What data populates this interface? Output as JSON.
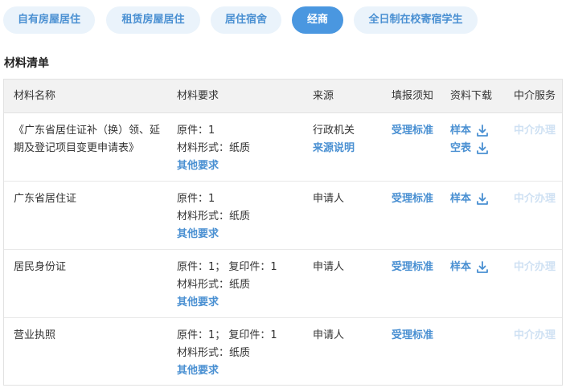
{
  "tabs": [
    {
      "label": "自有房屋居住",
      "active": false
    },
    {
      "label": "租赁房屋居住",
      "active": false
    },
    {
      "label": "居住宿舍",
      "active": false
    },
    {
      "label": "经商",
      "active": true
    },
    {
      "label": "全日制在校寄宿学生",
      "active": false
    }
  ],
  "section_title": "材料清单",
  "table": {
    "headers": [
      "材料名称",
      "材料要求",
      "来源",
      "填报须知",
      "资料下载",
      "中介服务"
    ],
    "rows": [
      {
        "name": "《广东省居住证补（换）领、延期及登记项目变更申请表》",
        "requirements": [
          "原件：1",
          "材料形式：纸质"
        ],
        "other_link": "其他要求",
        "source": "行政机关",
        "source_link": "来源说明",
        "fill_link": "受理标准",
        "downloads": [
          "样本",
          "空表"
        ],
        "agent": "中介办理"
      },
      {
        "name": "广东省居住证",
        "requirements": [
          "原件：1",
          "材料形式：纸质"
        ],
        "other_link": "其他要求",
        "source": "申请人",
        "source_link": "",
        "fill_link": "受理标准",
        "downloads": [
          "样本"
        ],
        "agent": "中介办理"
      },
      {
        "name": "居民身份证",
        "requirements": [
          "原件：1；  复印件：1",
          "材料形式：纸质"
        ],
        "other_link": "其他要求",
        "source": "申请人",
        "source_link": "",
        "fill_link": "受理标准",
        "downloads": [
          "样本"
        ],
        "agent": "中介办理"
      },
      {
        "name": "营业执照",
        "requirements": [
          "原件：1；  复印件：1",
          "材料形式：纸质"
        ],
        "other_link": "其他要求",
        "source": "申请人",
        "source_link": "",
        "fill_link": "受理标准",
        "downloads": [],
        "agent": "中介办理"
      }
    ]
  },
  "icons": {
    "download": "download-icon"
  },
  "colors": {
    "accent": "#4a90d2",
    "tab_bg": "#eaf3fb",
    "tab_active_bg": "#4a97e0",
    "disabled": "#cfe1f3",
    "header_bg": "#f2f2f2"
  }
}
